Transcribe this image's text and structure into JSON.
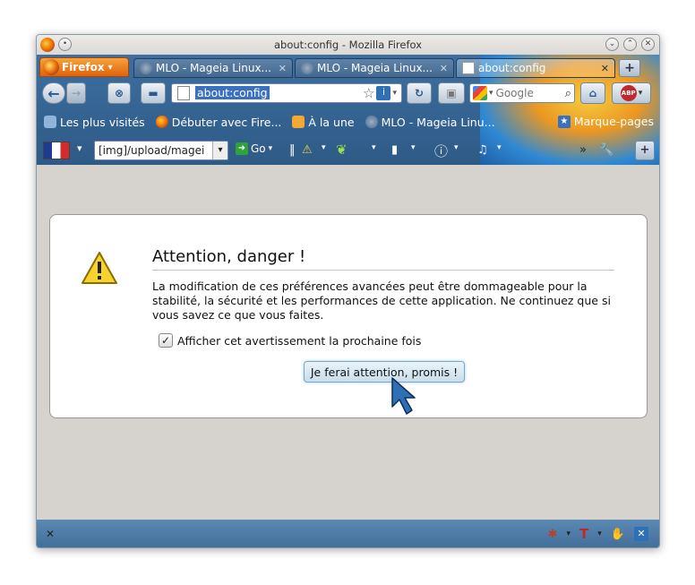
{
  "window": {
    "title": "about:config - Mozilla Firefox"
  },
  "firefox_menu": {
    "label": "Firefox"
  },
  "tabs": [
    {
      "label": "MLO - Mageia Linux..."
    },
    {
      "label": "MLO - Mageia Linux..."
    },
    {
      "label": "about:config"
    }
  ],
  "urlbar": {
    "value": "about:config"
  },
  "search": {
    "placeholder": "Google"
  },
  "bookmarks": {
    "items": [
      {
        "label": "Les plus visités"
      },
      {
        "label": "Débuter avec Fire..."
      },
      {
        "label": "À la une"
      },
      {
        "label": "MLO - Mageia Linu..."
      }
    ],
    "bookmarks_menu": "Marque-pages"
  },
  "addons": {
    "image_select": "[img]/upload/magei",
    "go_label": "Go"
  },
  "warning": {
    "title": "Attention, danger !",
    "text": "La modification de ces préférences avancées peut être dommageable pour la stabilité, la sécurité et les performances de cette application. Ne continuez que si vous savez ce que vous faites.",
    "checkbox_label": "Afficher cet avertissement la prochaine fois",
    "checkbox_checked": true,
    "button_label": "Je ferai attention, promis !"
  },
  "colors": {
    "chrome": "#3d6fa0",
    "content_bg": "#d6d3cf",
    "url_selection": "#3a70c2"
  }
}
